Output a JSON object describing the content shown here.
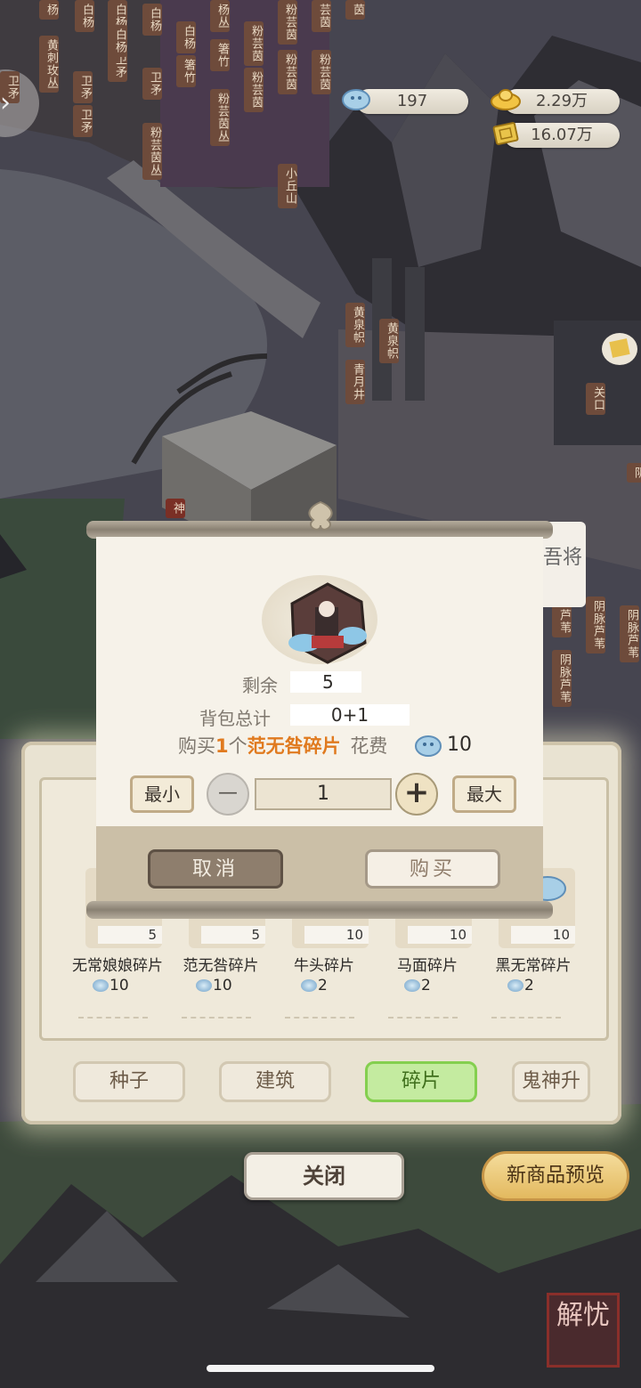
{
  "map": {
    "signs": [
      {
        "text": "杨"
      },
      {
        "text": "黄刺玫丛"
      },
      {
        "text": "白杨"
      },
      {
        "text": "卫矛"
      },
      {
        "text": "卫矛"
      },
      {
        "text": "白杨"
      },
      {
        "text": "卫矛"
      },
      {
        "text": "白杨"
      },
      {
        "text": "白杨"
      },
      {
        "text": "卫矛"
      },
      {
        "text": "粉芸茵丛"
      },
      {
        "text": "白杨"
      },
      {
        "text": "箸竹"
      },
      {
        "text": "杨丛"
      },
      {
        "text": "箸竹"
      },
      {
        "text": "粉芸茵丛"
      },
      {
        "text": "粉芸茵"
      },
      {
        "text": "粉芸茵"
      },
      {
        "text": "粉芸茵"
      },
      {
        "text": "粉芸茵"
      },
      {
        "text": "芸茵"
      },
      {
        "text": "粉芸茵"
      },
      {
        "text": "茵"
      },
      {
        "text": "小丘山"
      },
      {
        "text": "黄泉帜"
      },
      {
        "text": "青月井"
      },
      {
        "text": "黄泉帜"
      },
      {
        "text": "关口"
      },
      {
        "text": "阴"
      },
      {
        "text": "阴脉芦苇"
      },
      {
        "text": "阴脉芦苇"
      },
      {
        "text": "芦苇"
      },
      {
        "text": "阴脉芦苇"
      },
      {
        "text": "卫矛"
      },
      {
        "text": "神"
      }
    ],
    "side_text": "吾将"
  },
  "resources": {
    "soul_coin": "197",
    "gold": "2.29万",
    "paper": "16.07万"
  },
  "shop": {
    "items": [
      {
        "qty": "5",
        "name": "无常娘娘碎片",
        "cost": "10"
      },
      {
        "qty": "5",
        "name": "范无咎碎片",
        "cost": "10"
      },
      {
        "qty": "10",
        "name": "牛头碎片",
        "cost": "2"
      },
      {
        "qty": "10",
        "name": "马面碎片",
        "cost": "2"
      },
      {
        "qty": "10",
        "name": "黑无常碎片",
        "cost": "2"
      }
    ],
    "tabs": [
      {
        "label": "种子"
      },
      {
        "label": "建筑"
      },
      {
        "label": "碎片"
      },
      {
        "label": "鬼神升"
      }
    ],
    "close_label": "关闭",
    "preview_label": "新商品预览"
  },
  "dialog": {
    "remaining_label": "剩余",
    "remaining_value": "5",
    "bag_label": "背包总计",
    "bag_value": "0+1",
    "buy_prefix": "购买",
    "buy_count": "1",
    "buy_unit": "个",
    "buy_item": "范无咎碎片",
    "cost_label": "花费",
    "cost_value": "10",
    "min_label": "最小",
    "max_label": "最大",
    "quantity": "1",
    "minus_symbol": "—",
    "plus_symbol": "+",
    "cancel_label": "取消",
    "buy_label": "购买"
  },
  "corner_seal": {
    "text": "解忧"
  },
  "colors": {
    "accent_orange": "#e07a1f",
    "active_tab": "#c4eba0",
    "dialog_bg": "#f6f2e9"
  }
}
